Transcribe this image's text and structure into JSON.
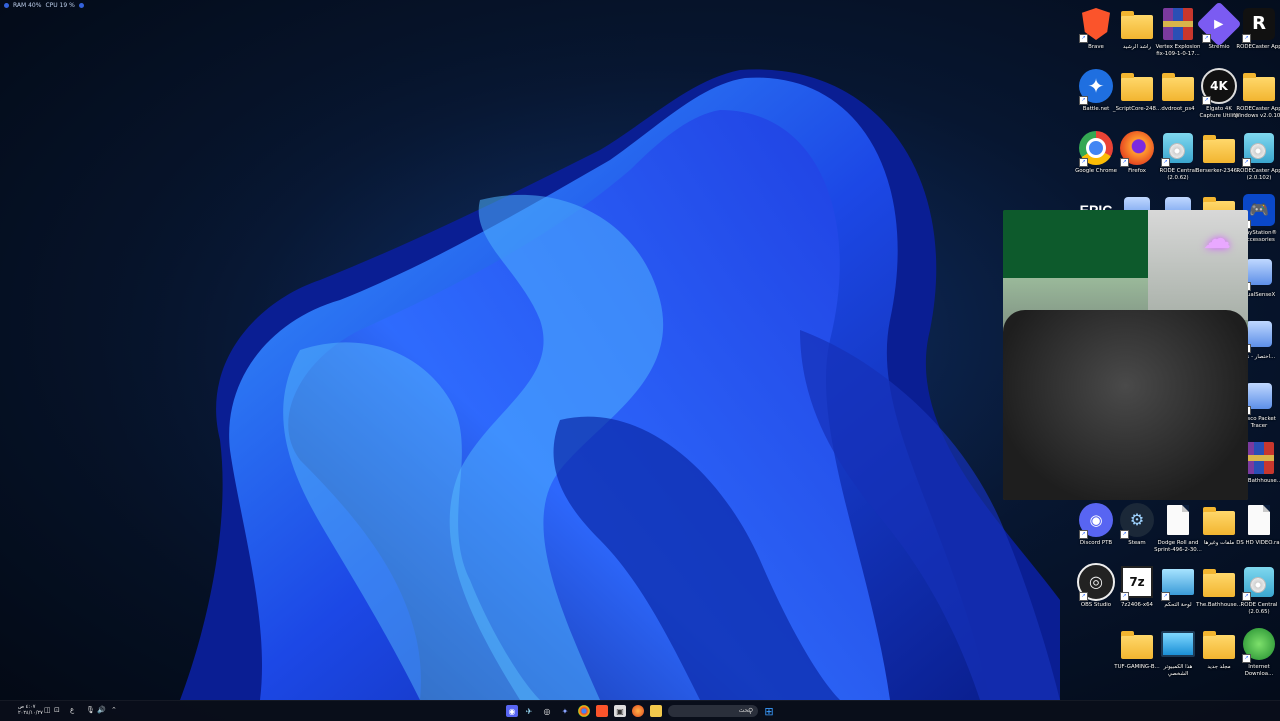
{
  "perf_overlay": {
    "ram": "RAM 40%",
    "cpu": "CPU 19 %"
  },
  "desktop_icons": [
    {
      "name": "brave",
      "label": "Brave",
      "kind": "brave"
    },
    {
      "name": "folder-rashed",
      "label": "راشد الرشيد",
      "kind": "folder"
    },
    {
      "name": "vertex-explosion",
      "label": "Vertex Explosion\nfix-109-1-0-17...",
      "kind": "winrar"
    },
    {
      "name": "stremio",
      "label": "Stremio",
      "kind": "stremio"
    },
    {
      "name": "rodecaster-app",
      "label": "RODECaster App",
      "kind": "rode"
    },
    {
      "name": "battlenet",
      "label": "Battle.net",
      "kind": "battlenet"
    },
    {
      "name": "scriptcore",
      "label": "_ScriptCore-248...",
      "kind": "folder"
    },
    {
      "name": "dvdroot",
      "label": "dvdroot_ps4",
      "kind": "folder"
    },
    {
      "name": "elgato-4k",
      "label": "Elgato 4K\nCapture Utility",
      "kind": "elgato"
    },
    {
      "name": "rodecaster-windows",
      "label": "RODECaster App\nWindows v2.0.102",
      "kind": "folder"
    },
    {
      "name": "chrome",
      "label": "Google Chrome",
      "kind": "chrome"
    },
    {
      "name": "firefox",
      "label": "Firefox",
      "kind": "firefox"
    },
    {
      "name": "rode-central-1",
      "label": "RODE Central\n(2.0.62)",
      "kind": "disc"
    },
    {
      "name": "berserker",
      "label": "Berserker-2346...",
      "kind": "folder"
    },
    {
      "name": "rodecaster-app-2",
      "label": "RODECaster App\n(2.0.102)",
      "kind": "disc"
    },
    {
      "name": "epic",
      "label": "",
      "kind": "epic"
    },
    {
      "name": "app-r4c2",
      "label": "",
      "kind": "small"
    },
    {
      "name": "app-r4c3",
      "label": "",
      "kind": "small"
    },
    {
      "name": "app-r4c4",
      "label": "",
      "kind": "folder"
    },
    {
      "name": "playstation-accessories",
      "label": "PlayStation®\nAccessories",
      "kind": "ps"
    },
    {
      "name": "dualsensex",
      "label": "DualSenseX",
      "kind": "small"
    },
    {
      "name": "ikhtisar",
      "label": "اختصار - نظ...",
      "kind": "small"
    },
    {
      "name": "cisco-packet-tracer",
      "label": "Cisco Packet\nTracer",
      "kind": "small"
    },
    {
      "name": "bathhouse-rar",
      "label": "The.Bathhouse...",
      "kind": "winrar"
    },
    {
      "name": "discord-ptb",
      "label": "Discord PTB",
      "kind": "discord"
    },
    {
      "name": "steam",
      "label": "Steam",
      "kind": "steam"
    },
    {
      "name": "dodge-roll",
      "label": "Dodge Roll and\nSprint-496-2-30...",
      "kind": "doc"
    },
    {
      "name": "folder-malafat",
      "label": "ملفات وغيرها",
      "kind": "folder"
    },
    {
      "name": "ds-hd-video",
      "label": "DS HD VIDEO.rar",
      "kind": "doc"
    },
    {
      "name": "obs-studio",
      "label": "OBS Studio",
      "kind": "obs"
    },
    {
      "name": "7z2406",
      "label": "7z2406-x64",
      "kind": "sevenzip"
    },
    {
      "name": "control-panel",
      "label": "لوحة التحكم",
      "kind": "cpanel"
    },
    {
      "name": "bathhouse-folder",
      "label": "The.Bathhouse...",
      "kind": "folder"
    },
    {
      "name": "rode-central-2",
      "label": "RODE Central\n(2.0.65)",
      "kind": "disc"
    },
    {
      "name": "tuf-gaming",
      "label": "TUF-GAMING-B...",
      "kind": "folder"
    },
    {
      "name": "this-pc",
      "label": "هذا الكمبيوتر\nالشخصي",
      "kind": "monitor"
    },
    {
      "name": "new-folder",
      "label": "مجلد جديد",
      "kind": "folder"
    },
    {
      "name": "internet-download",
      "label": "Internet\nDownloa...",
      "kind": "idm"
    }
  ],
  "taskbar": {
    "search_placeholder": "بحث",
    "clock_time": "٤:٠٧ ص",
    "clock_date": "٢٠٢٤/١٠/٢٧",
    "lang": "ع"
  },
  "colors": {
    "taskbar_bg": "#0a0e1a",
    "accent": "#3a6cf0"
  }
}
